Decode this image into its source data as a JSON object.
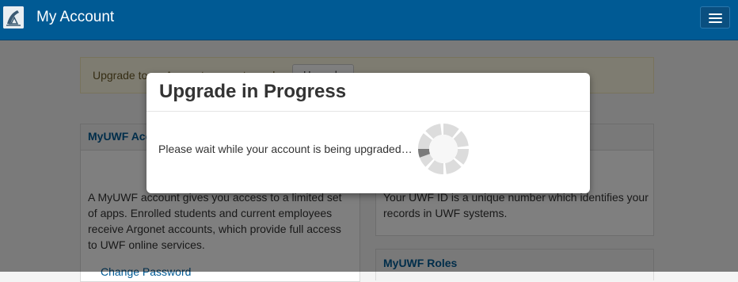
{
  "app": {
    "title": "My Account",
    "logo_icon": "uwf-logo",
    "menu_icon": "hamburger-menu-icon"
  },
  "alert": {
    "text": "Upgrade to an Argonet account now by",
    "button_label": "Upgrade"
  },
  "panels": {
    "myuwf_account": {
      "title": "MyUWF Account",
      "body": "A MyUWF account gives you access to a limited set of apps. Enrolled students and current employees receive Argonet accounts, which provide full access to UWF online services.",
      "link": "Change Password"
    },
    "uwf_id": {
      "body": "Your UWF ID is a unique number which identifies your records in UWF systems."
    },
    "myuwf_roles": {
      "title": "MyUWF Roles"
    }
  },
  "modal": {
    "title": "Upgrade in Progress",
    "message": "Please wait while your account is being upgraded…",
    "spinner_icon": "loading-spinner-icon"
  },
  "colors": {
    "navbar": "#005a94",
    "link": "#005a94",
    "alert_bg": "#fcf8e3"
  }
}
